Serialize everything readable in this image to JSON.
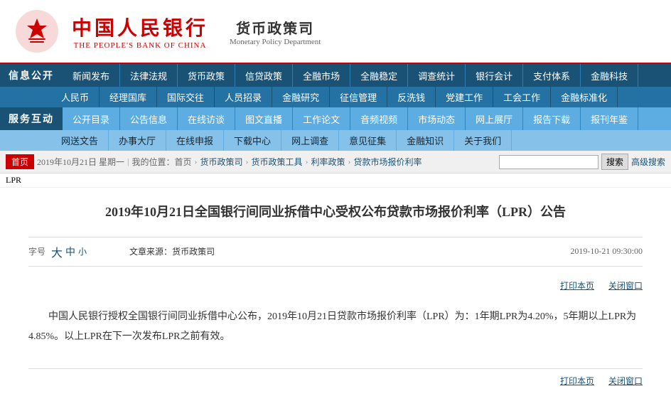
{
  "header": {
    "logo_cn": "中国人民银行",
    "logo_en": "THE PEOPLE'S BANK OF CHINA",
    "dept_cn": "货币政策司",
    "dept_en": "Monetary Policy Department"
  },
  "nav": {
    "left_labels": [
      "信息公开",
      "服务互动"
    ],
    "row1": [
      "新闻发布",
      "法律法规",
      "货币政策",
      "信贷政策",
      "全融市场",
      "全融稳定",
      "调查统计",
      "银行会计",
      "支付体系",
      "金融科技"
    ],
    "row2": [
      "人民币",
      "经理国库",
      "国际交往",
      "人员招录",
      "金融研究",
      "征信管理",
      "反洗钱",
      "党建工作",
      "工会工作",
      "金融标准化"
    ],
    "row3": [
      "公开目录",
      "公告信息",
      "在线访谈",
      "图文直播",
      "工作论文",
      "音频视频",
      "市场动态",
      "网上展厅",
      "报告下载",
      "报刊年鉴"
    ],
    "row4": [
      "网送文告",
      "办事大厅",
      "在线申报",
      "下载中心",
      "网上调查",
      "意见征集",
      "金融知识",
      "关于我们"
    ]
  },
  "breadcrumb": {
    "home": "首页",
    "date": "2019年10月21日 星期一",
    "separator": "|",
    "location_label": "我的位置：首页",
    "path": [
      "货币政策司",
      "货币政策工具",
      "利率政策",
      "贷款市场报价利率"
    ],
    "current": "LPR",
    "search_placeholder": "",
    "search_btn": "搜索",
    "advanced_search": "高级搜索"
  },
  "article": {
    "title": "2019年10月21日全国银行间同业拆借中心受权公布贷款市场报价利率（LPR）公告",
    "font_label": "字号",
    "font_large": "大",
    "font_medium": "中",
    "font_small": "小",
    "source_label": "文章来源：",
    "source": "货币政策司",
    "date": "2019-10-21  09:30:00",
    "print": "打印本页",
    "close": "关闭窗口",
    "body": "中国人民银行授权全国银行间同业拆借中心公布，2019年10月21日贷款市场报价利率（LPR）为：1年期LPR为4.20%，5年期以上LPR为4.85%。以上LPR在下一次发布LPR之前有效。"
  }
}
